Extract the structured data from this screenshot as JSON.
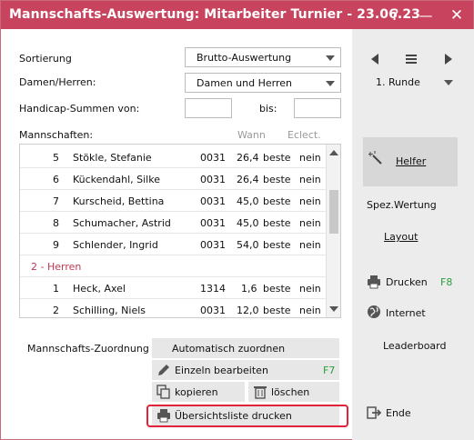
{
  "window": {
    "title": "Mannschafts-Auswertung: Mitarbeiter Turnier - 23.06.23"
  },
  "titlebar": {
    "help": "?",
    "minimize": "—",
    "close": "✕"
  },
  "form": {
    "sort_label": "Sortierung",
    "sort_value": "Brutto-Auswertung",
    "gender_label": "Damen/Herren:",
    "gender_value": "Damen und Herren",
    "hcp_label": "Handicap-Summen von:",
    "bis_label": "bis:",
    "teams_label": "Mannschaften:",
    "col_wann": "Wann",
    "col_eclect": "Eclect."
  },
  "teams": {
    "rows1": [
      {
        "num": "5",
        "name": "Stökle, Stefanie",
        "id": "0031",
        "hcp": "26,4",
        "wann": "beste",
        "eclect": "nein"
      },
      {
        "num": "6",
        "name": "Kückendahl, Silke",
        "id": "0031",
        "hcp": "26,4",
        "wann": "beste",
        "eclect": "nein"
      },
      {
        "num": "7",
        "name": "Kurscheid, Bettina",
        "id": "0031",
        "hcp": "45,0",
        "wann": "beste",
        "eclect": "nein"
      },
      {
        "num": "8",
        "name": "Schumacher, Astrid",
        "id": "0031",
        "hcp": "45,0",
        "wann": "beste",
        "eclect": "nein"
      },
      {
        "num": "9",
        "name": "Schlender, Ingrid",
        "id": "0031",
        "hcp": "54,0",
        "wann": "beste",
        "eclect": "nein"
      }
    ],
    "group2": "2 - Herren",
    "rows2": [
      {
        "num": "1",
        "name": "Heck, Axel",
        "id": "1314",
        "hcp": "1,6",
        "wann": "beste",
        "eclect": "nein"
      },
      {
        "num": "2",
        "name": "Schilling, Niels",
        "id": "0031",
        "hcp": "12,0",
        "wann": "beste",
        "eclect": "nein"
      }
    ]
  },
  "assign": {
    "label": "Mannschafts-Zuordnung",
    "auto": "Automatisch zuordnen",
    "edit": "Einzeln bearbeiten",
    "edit_key": "F7",
    "copy": "kopieren",
    "delete": "löschen",
    "print_list": "Übersichtsliste drucken"
  },
  "sidebar": {
    "round_value": "1. Runde",
    "helfer": "Helfer",
    "spez": "Spez.Wertung",
    "layout": "Layout",
    "drucken": "Drucken",
    "drucken_key": "F8",
    "internet": "Internet",
    "leaderboard": "Leaderboard",
    "ende": "Ende"
  },
  "colors": {
    "title_bg": "#c8445e",
    "accent_red": "#c0384f",
    "key_green": "#2a9d3a"
  }
}
